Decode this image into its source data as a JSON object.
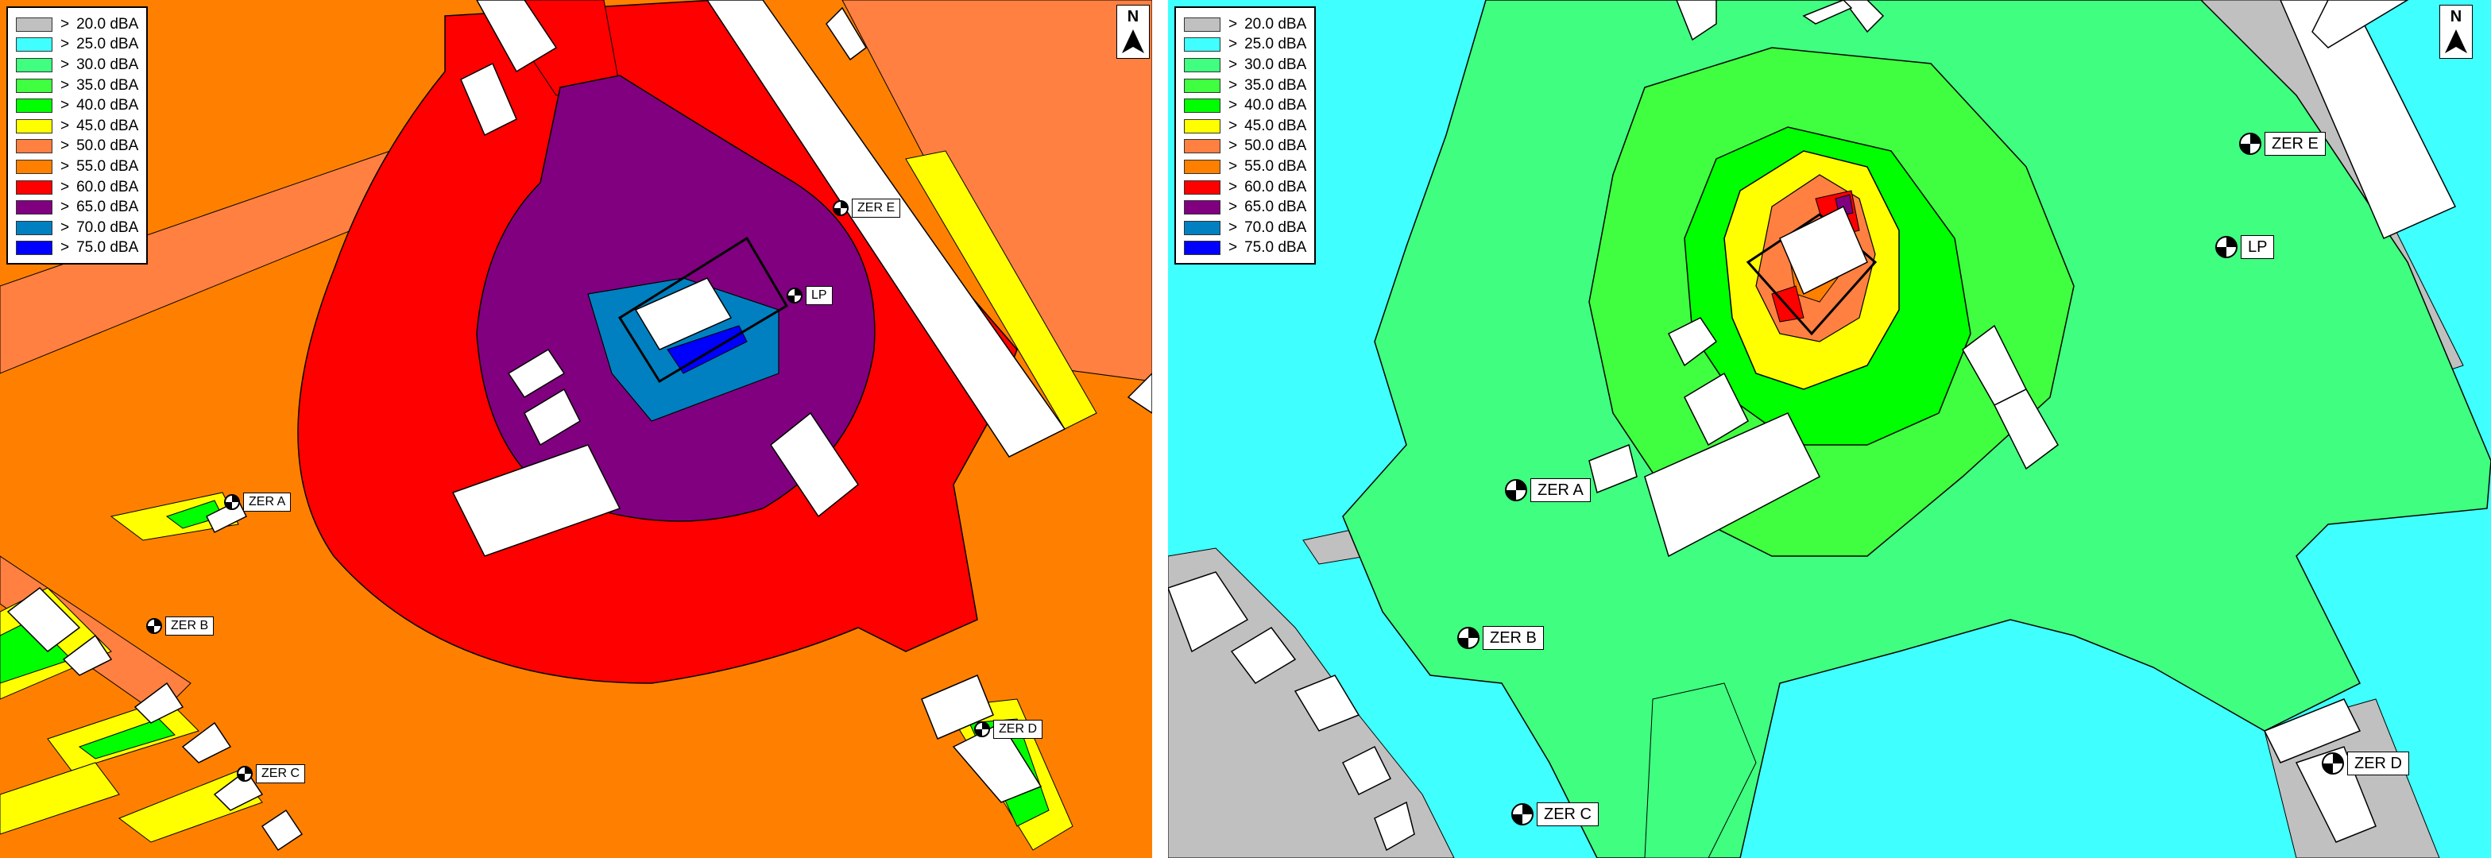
{
  "panels": [
    {
      "id": "left",
      "legend": [
        {
          "op": ">",
          "label": "20.0 dBA",
          "color": "#c0c0c0"
        },
        {
          "op": ">",
          "label": "25.0 dBA",
          "color": "#40ffff"
        },
        {
          "op": ">",
          "label": "30.0 dBA",
          "color": "#40ff80"
        },
        {
          "op": ">",
          "label": "35.0 dBA",
          "color": "#40ff40"
        },
        {
          "op": ">",
          "label": "40.0 dBA",
          "color": "#00ff00"
        },
        {
          "op": ">",
          "label": "45.0 dBA",
          "color": "#ffff00"
        },
        {
          "op": ">",
          "label": "50.0 dBA",
          "color": "#ff8040"
        },
        {
          "op": ">",
          "label": "55.0 dBA",
          "color": "#ff8000"
        },
        {
          "op": ">",
          "label": "60.0 dBA",
          "color": "#ff0000"
        },
        {
          "op": ">",
          "label": "65.0 dBA",
          "color": "#800080"
        },
        {
          "op": ">",
          "label": "70.0 dBA",
          "color": "#0080c0"
        },
        {
          "op": ">",
          "label": "75.0 dBA",
          "color": "#0000ff"
        }
      ],
      "north_label": "N",
      "receivers": [
        {
          "id": "zer-a",
          "label": "ZER A"
        },
        {
          "id": "zer-b",
          "label": "ZER B"
        },
        {
          "id": "zer-c",
          "label": "ZER C"
        },
        {
          "id": "zer-d",
          "label": "ZER D"
        },
        {
          "id": "zer-e",
          "label": "ZER E"
        },
        {
          "id": "lp",
          "label": "LP"
        }
      ]
    },
    {
      "id": "right",
      "legend": [
        {
          "op": ">",
          "label": "20.0 dBA",
          "color": "#c0c0c0"
        },
        {
          "op": ">",
          "label": "25.0 dBA",
          "color": "#40ffff"
        },
        {
          "op": ">",
          "label": "30.0 dBA",
          "color": "#40ff80"
        },
        {
          "op": ">",
          "label": "35.0 dBA",
          "color": "#40ff40"
        },
        {
          "op": ">",
          "label": "40.0 dBA",
          "color": "#00ff00"
        },
        {
          "op": ">",
          "label": "45.0 dBA",
          "color": "#ffff00"
        },
        {
          "op": ">",
          "label": "50.0 dBA",
          "color": "#ff8040"
        },
        {
          "op": ">",
          "label": "55.0 dBA",
          "color": "#ff8000"
        },
        {
          "op": ">",
          "label": "60.0 dBA",
          "color": "#ff0000"
        },
        {
          "op": ">",
          "label": "65.0 dBA",
          "color": "#800080"
        },
        {
          "op": ">",
          "label": "70.0 dBA",
          "color": "#0080c0"
        },
        {
          "op": ">",
          "label": "75.0 dBA",
          "color": "#0000ff"
        }
      ],
      "north_label": "N",
      "receivers": [
        {
          "id": "zer-a",
          "label": "ZER A"
        },
        {
          "id": "zer-b",
          "label": "ZER B"
        },
        {
          "id": "zer-c",
          "label": "ZER C"
        },
        {
          "id": "zer-d",
          "label": "ZER D"
        },
        {
          "id": "zer-e",
          "label": "ZER E"
        },
        {
          "id": "lp",
          "label": "LP"
        }
      ]
    }
  ]
}
